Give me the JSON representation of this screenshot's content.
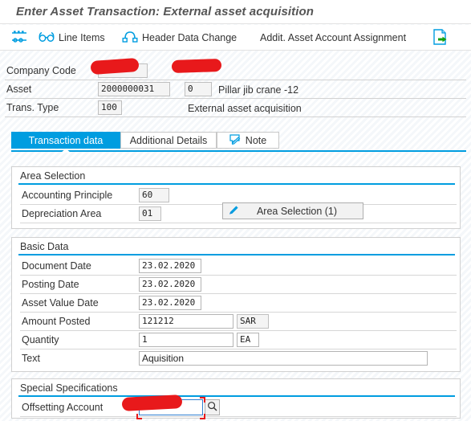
{
  "window": {
    "title": "Enter Asset Transaction: External asset acquisition"
  },
  "toolbar": {
    "items": [
      {
        "label": "",
        "icon": "simulate-icon"
      },
      {
        "label": "Line Items",
        "icon": "glasses-icon"
      },
      {
        "label": "Header Data Change",
        "icon": "header-change-icon"
      },
      {
        "label": "Addit. Asset Account Assignment",
        "icon": ""
      },
      {
        "label": "",
        "icon": "post-document-icon"
      }
    ]
  },
  "header": {
    "company_code": {
      "label": "Company Code",
      "value": ""
    },
    "asset": {
      "label": "Asset",
      "value": "2000000031",
      "subnumber": "0",
      "description": "Pillar jib crane -12"
    },
    "trans_type": {
      "label": "Trans. Type",
      "value": "100",
      "description": "External asset acquisition"
    }
  },
  "tabs": [
    {
      "label": "Transaction data",
      "active": true,
      "icon": ""
    },
    {
      "label": "Additional Details",
      "active": false,
      "icon": ""
    },
    {
      "label": "Note",
      "active": false,
      "icon": "note-icon"
    }
  ],
  "area_selection": {
    "title": "Area Selection",
    "accounting_principle": {
      "label": "Accounting Principle",
      "value": "60"
    },
    "depreciation_area": {
      "label": "Depreciation Area",
      "value": "01"
    },
    "button": {
      "label": "Area Selection (1)",
      "icon": "pencil-icon"
    }
  },
  "basic_data": {
    "title": "Basic Data",
    "rows": [
      {
        "label": "Document Date",
        "value": "23.02.2020"
      },
      {
        "label": "Posting Date",
        "value": "23.02.2020"
      },
      {
        "label": "Asset Value Date",
        "value": "23.02.2020"
      }
    ],
    "amount_posted": {
      "label": "Amount Posted",
      "value": "121212",
      "currency": "SAR"
    },
    "quantity": {
      "label": "Quantity",
      "value": "1",
      "unit": "EA"
    },
    "text": {
      "label": "Text",
      "value": "Aquisition"
    }
  },
  "special_specifications": {
    "title": "Special Specifications",
    "offsetting_account": {
      "label": "Offsetting Account",
      "value": "",
      "search_icon": "search-icon"
    }
  },
  "colors": {
    "accent": "#009de0",
    "redaction": "#e8191b",
    "focus_border": "#2f7fd0"
  }
}
